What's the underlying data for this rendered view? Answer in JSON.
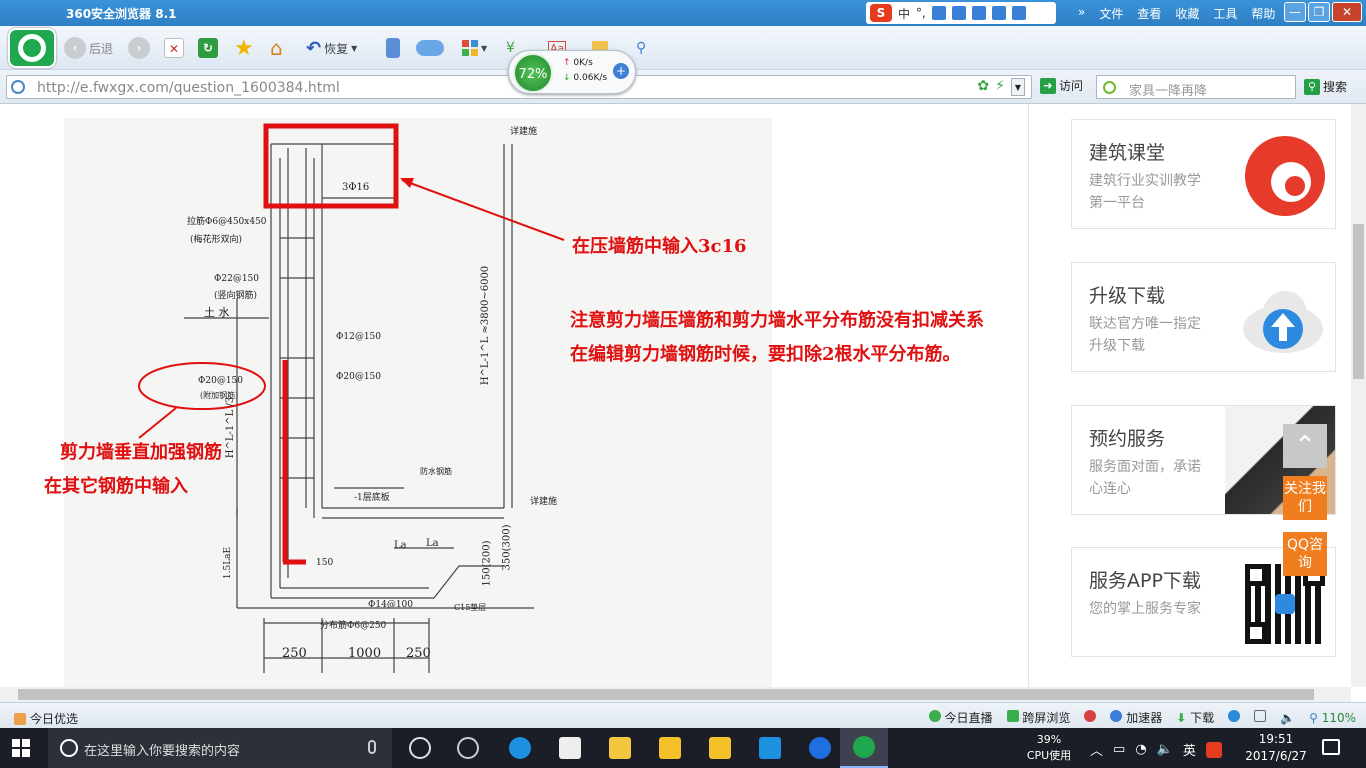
{
  "window": {
    "title": "360安全浏览器 8.1",
    "menu": [
      "文件",
      "查看",
      "收藏",
      "工具",
      "帮助"
    ],
    "controls": [
      "minimize",
      "restore",
      "close"
    ]
  },
  "ime": {
    "label": "中",
    "extras": "°,"
  },
  "toolbar": {
    "back_label": "后退",
    "restore_label": "恢复",
    "icons": [
      "back-icon",
      "forward-icon",
      "close-tab-icon",
      "refresh-icon",
      "favorites-star-icon",
      "home-icon",
      "restore-icon",
      "phone-icon",
      "cloud-icon",
      "apps-icon",
      "translate-icon",
      "screenshot-icon",
      "magnifier-icon"
    ]
  },
  "speed_meter": {
    "percent": "72%",
    "up": "0K/s",
    "down": "0.06K/s"
  },
  "address": {
    "url": "http://e.fwxgx.com/question_1600384.html",
    "visit_label": "访问",
    "search_placeholder": "家具一降再降",
    "search_button": "搜索"
  },
  "drawing": {
    "annotations": {
      "top": "在压墙筋中输入3c16",
      "note_line1": "注意剪力墙压墙筋和剪力墙水平分布筋没有扣减关系",
      "note_line2": "在编辑剪力墙钢筋时候，要扣除2根水平分布筋。",
      "left_line1": "剪力墙垂直加强钢筋",
      "left_line2": "在其它钢筋中输入"
    },
    "labels": {
      "top_bar": "3Φ16",
      "stirrup": "拉筋Φ6@450x450",
      "stirrup_note": "(梅花形双向)",
      "bar1": "Φ22@150",
      "bar1_note": "(竖向钢筋)",
      "soil": "土 水",
      "bar2": "Φ12@150",
      "bar3": "Φ20@150",
      "bar_circled": "Φ20@150",
      "bar_circled_note": "(附加钢筋)",
      "waterproof": "防水钢筋",
      "floor": "-1层底板",
      "la1": "La",
      "la2": "La",
      "bottom_bar": "Φ14@100",
      "dist_bar": "分布筋Φ6@250",
      "c15": "C15垫层",
      "dim_150": "150",
      "detail1": "详建施",
      "detail2": "详建施",
      "height": "H^L-1^L ≈3800~6000",
      "h_left": "H^L-1^L /3",
      "lae": "1.5LaE",
      "thick": "150(200)",
      "thick2": "350(300)",
      "dim1": "250",
      "dim2": "1000",
      "dim3": "250"
    }
  },
  "sidebar_cards": [
    {
      "title": "建筑课堂",
      "subtitle": "建筑行业实训教学第一平台",
      "icon": "brand-logo-icon"
    },
    {
      "title": "升级下载",
      "subtitle": "联达官方唯一指定升级下载",
      "icon": "cloud-upload-icon"
    },
    {
      "title": "预约服务",
      "subtitle": "服务面对面，承诺心连心",
      "icon": "handshake-photo-icon"
    },
    {
      "title": "服务APP下载",
      "subtitle": "您的掌上服务专家",
      "icon": "qr-code-icon"
    }
  ],
  "float_buttons": {
    "follow": "关注我们",
    "qq": "QQ咨询"
  },
  "statusbar": {
    "today": "今日优选",
    "live": "今日直播",
    "cross_screen": "跨屏浏览",
    "accelerator": "加速器",
    "download": "下载",
    "zoom": "110%"
  },
  "taskbar": {
    "search_placeholder": "在这里输入你要搜索的内容",
    "cpu_percent": "39%",
    "cpu_label": "CPU使用",
    "ime": "英",
    "time": "19:51",
    "date": "2017/6/27"
  },
  "colors": {
    "accent_red": "#e01010",
    "orange": "#f07d1e",
    "brand_green": "#1fa84f"
  }
}
